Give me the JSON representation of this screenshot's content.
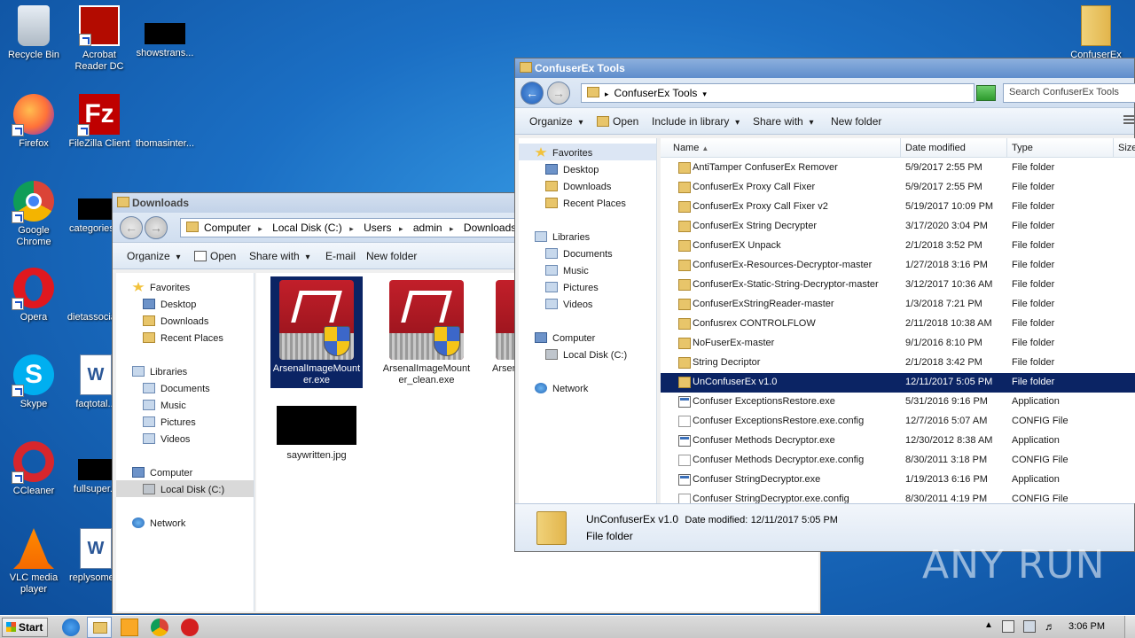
{
  "desktop": {
    "icons": [
      {
        "label": "Recycle Bin"
      },
      {
        "label": "Acrobat Reader DC"
      },
      {
        "label": "showstrans..."
      },
      {
        "label": "Firefox"
      },
      {
        "label": "FileZilla Client"
      },
      {
        "label": "thomasinter..."
      },
      {
        "label": "Google Chrome"
      },
      {
        "label": "categories..."
      },
      {
        "label": "Opera"
      },
      {
        "label": "dietassocia..."
      },
      {
        "label": "Skype"
      },
      {
        "label": "faqtotal..."
      },
      {
        "label": "CCleaner"
      },
      {
        "label": "fullsuper..."
      },
      {
        "label": "VLC media player"
      },
      {
        "label": "replysome..."
      },
      {
        "label": "ConfuserEx"
      }
    ]
  },
  "downloads_window": {
    "title": "Downloads",
    "breadcrumbs": [
      "Computer",
      "Local Disk (C:)",
      "Users",
      "admin",
      "Downloads"
    ],
    "toolbar": {
      "organize": "Organize",
      "open": "Open",
      "share_with": "Share with",
      "email": "E-mail",
      "new_folder": "New folder"
    },
    "nav": {
      "favorites": "Favorites",
      "desktop": "Desktop",
      "downloads": "Downloads",
      "recent": "Recent Places",
      "libraries": "Libraries",
      "documents": "Documents",
      "music": "Music",
      "pictures": "Pictures",
      "videos": "Videos",
      "computer": "Computer",
      "local_disk": "Local Disk (C:)",
      "network": "Network"
    },
    "files": [
      {
        "name": "ArsenalImageMounter.exe"
      },
      {
        "name": "ArsenalImageMounter_clean.exe"
      },
      {
        "name": "Arsenal...ter_c..."
      },
      {
        "name": "saywritten.jpg"
      }
    ]
  },
  "confuser_window": {
    "title": "ConfuserEx Tools",
    "breadcrumb": "ConfuserEx Tools",
    "search_placeholder": "Search ConfuserEx Tools",
    "toolbar": {
      "organize": "Organize",
      "open": "Open",
      "include": "Include in library",
      "share_with": "Share with",
      "new_folder": "New folder"
    },
    "nav": {
      "favorites": "Favorites",
      "desktop": "Desktop",
      "downloads": "Downloads",
      "recent": "Recent Places",
      "libraries": "Libraries",
      "documents": "Documents",
      "music": "Music",
      "pictures": "Pictures",
      "videos": "Videos",
      "computer": "Computer",
      "local_disk": "Local Disk (C:)",
      "network": "Network"
    },
    "columns": {
      "name": "Name",
      "date": "Date modified",
      "type": "Type",
      "size": "Size"
    },
    "rows": [
      {
        "name": "AntiTamper ConfuserEx Remover",
        "date": "5/9/2017 2:55 PM",
        "type": "File folder",
        "icon": "folder"
      },
      {
        "name": "ConfuserEx Proxy Call Fixer",
        "date": "5/9/2017 2:55 PM",
        "type": "File folder",
        "icon": "folder"
      },
      {
        "name": "ConfuserEx Proxy Call Fixer v2",
        "date": "5/19/2017 10:09 PM",
        "type": "File folder",
        "icon": "folder"
      },
      {
        "name": "ConfuserEx String Decrypter",
        "date": "3/17/2020 3:04 PM",
        "type": "File folder",
        "icon": "folder"
      },
      {
        "name": "ConfuserEX Unpack",
        "date": "2/1/2018 3:52 PM",
        "type": "File folder",
        "icon": "folder"
      },
      {
        "name": "ConfuserEx-Resources-Decryptor-master",
        "date": "1/27/2018 3:16 PM",
        "type": "File folder",
        "icon": "folder"
      },
      {
        "name": "ConfuserEx-Static-String-Decryptor-master",
        "date": "3/12/2017 10:36 AM",
        "type": "File folder",
        "icon": "folder"
      },
      {
        "name": "ConfuserExStringReader-master",
        "date": "1/3/2018 7:21 PM",
        "type": "File folder",
        "icon": "folder"
      },
      {
        "name": "Confusrex CONTROLFLOW",
        "date": "2/11/2018 10:38 AM",
        "type": "File folder",
        "icon": "folder"
      },
      {
        "name": "NoFuserEx-master",
        "date": "9/1/2016 8:10 PM",
        "type": "File folder",
        "icon": "folder"
      },
      {
        "name": "String Decriptor",
        "date": "2/1/2018 3:42 PM",
        "type": "File folder",
        "icon": "folder"
      },
      {
        "name": "UnConfuserEx v1.0",
        "date": "12/11/2017 5:05 PM",
        "type": "File folder",
        "icon": "folder",
        "selected": true
      },
      {
        "name": "Confuser ExceptionsRestore.exe",
        "date": "5/31/2016 9:16 PM",
        "type": "Application",
        "icon": "app"
      },
      {
        "name": "Confuser ExceptionsRestore.exe.config",
        "date": "12/7/2016 5:07 AM",
        "type": "CONFIG File",
        "icon": "cfg"
      },
      {
        "name": "Confuser Methods Decryptor.exe",
        "date": "12/30/2012 8:38 AM",
        "type": "Application",
        "icon": "app"
      },
      {
        "name": "Confuser Methods Decryptor.exe.config",
        "date": "8/30/2011 3:18 PM",
        "type": "CONFIG File",
        "icon": "cfg"
      },
      {
        "name": "Confuser StringDecryptor.exe",
        "date": "1/19/2013 6:16 PM",
        "type": "Application",
        "icon": "app"
      },
      {
        "name": "Confuser StringDecryptor.exe.config",
        "date": "8/30/2011 4:19 PM",
        "type": "CONFIG File",
        "icon": "cfg"
      }
    ],
    "details": {
      "name": "UnConfuserEx v1.0",
      "date_label": "Date modified:",
      "date": "12/11/2017 5:05 PM",
      "type": "File folder"
    }
  },
  "taskbar": {
    "start": "Start",
    "clock": "3:06 PM"
  },
  "watermark": "ANY RUN"
}
